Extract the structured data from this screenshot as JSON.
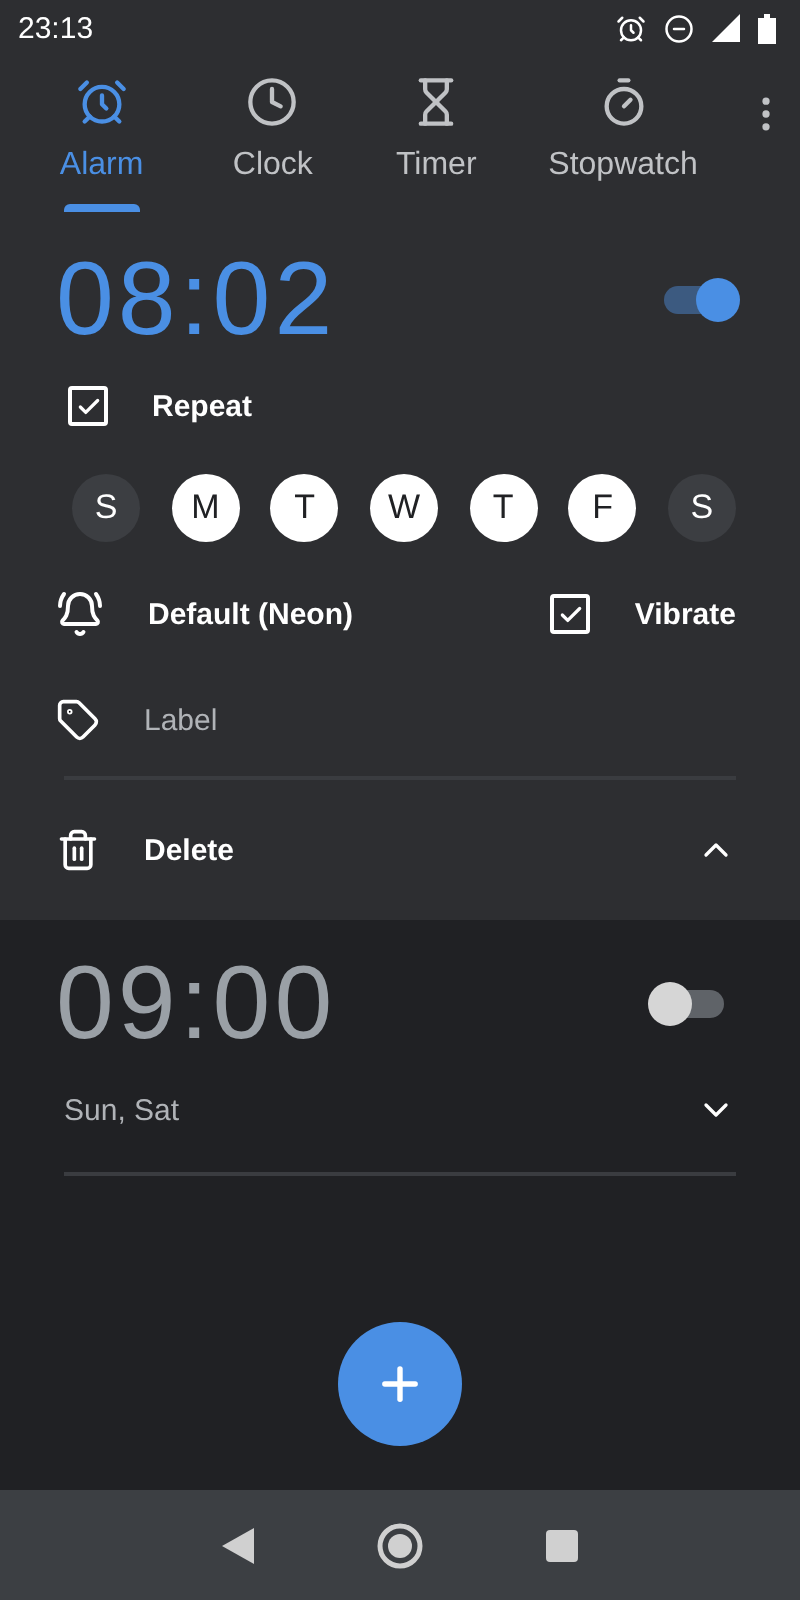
{
  "status_bar": {
    "time": "23:13"
  },
  "tabs": [
    {
      "label": "Alarm",
      "selected": true
    },
    {
      "label": "Clock",
      "selected": false
    },
    {
      "label": "Timer",
      "selected": false
    },
    {
      "label": "Stopwatch",
      "selected": false
    }
  ],
  "alarms": [
    {
      "time": "08:02",
      "on": true,
      "expanded": true,
      "repeat": {
        "label": "Repeat",
        "checked": true
      },
      "days": [
        {
          "letter": "S",
          "selected": false
        },
        {
          "letter": "M",
          "selected": true
        },
        {
          "letter": "T",
          "selected": true
        },
        {
          "letter": "W",
          "selected": true
        },
        {
          "letter": "T",
          "selected": true
        },
        {
          "letter": "F",
          "selected": true
        },
        {
          "letter": "S",
          "selected": false
        }
      ],
      "ringtone": "Default (Neon)",
      "vibrate": {
        "label": "Vibrate",
        "checked": true
      },
      "label_placeholder": "Label",
      "delete_label": "Delete"
    },
    {
      "time": "09:00",
      "on": false,
      "expanded": false,
      "summary": "Sun, Sat"
    }
  ]
}
